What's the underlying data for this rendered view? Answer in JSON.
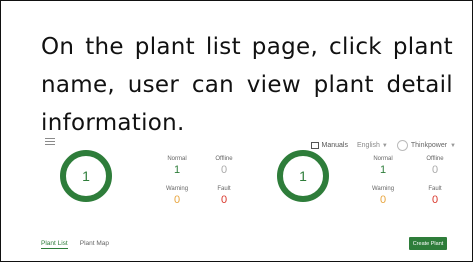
{
  "caption": "On the plant list page, click plant name, user can view plant detail information.",
  "header": {
    "manuals_label": "Manuals",
    "language": "English",
    "username": "Thinkpower"
  },
  "summary_left": {
    "total": "1",
    "normal_label": "Normal",
    "normal": "1",
    "offline_label": "Offline",
    "offline": "0",
    "warning_label": "Warning",
    "warning": "0",
    "fault_label": "Fault",
    "fault": "0"
  },
  "summary_right": {
    "total": "1",
    "normal_label": "Normal",
    "normal": "1",
    "offline_label": "Offline",
    "offline": "0",
    "warning_label": "Warning",
    "warning": "0",
    "fault_label": "Fault",
    "fault": "0"
  },
  "tabs": [
    {
      "label": "Plant List",
      "active": true
    },
    {
      "label": "Plant Map",
      "active": false
    }
  ],
  "create_button": "Create Plant",
  "colors": {
    "accent": "#2e7d3a",
    "warning": "#e8a43c",
    "fault": "#d9362b"
  }
}
